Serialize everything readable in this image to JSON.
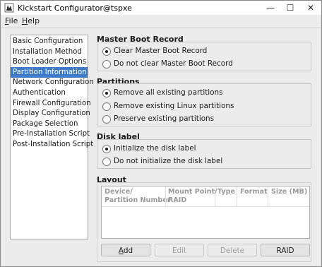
{
  "window": {
    "title": "Kickstart Configurator@tspxe",
    "minimize_glyph": "—",
    "maximize_glyph": "☐",
    "close_glyph": "✕"
  },
  "menu": {
    "file_ul": "F",
    "file_rest": "ile",
    "help_ul": "H",
    "help_rest": "elp"
  },
  "sidebar": {
    "items": [
      "Basic Configuration",
      "Installation Method",
      "Boot Loader Options",
      "Partition Information",
      "Network Configuration",
      "Authentication",
      "Firewall Configuration",
      "Display Configuration",
      "Package Selection",
      "Pre-Installation Script",
      "Post-Installation Script"
    ],
    "selected": "Partition Information"
  },
  "mbr": {
    "title": "Master Boot Record",
    "options": [
      "Clear Master Boot Record",
      "Do not clear Master Boot Record"
    ],
    "selected": "Clear Master Boot Record"
  },
  "partitions": {
    "title": "Partitions",
    "options": [
      "Remove all existing partitions",
      "Remove existing Linux partitions",
      "Preserve existing partitions"
    ],
    "selected": "Remove all existing partitions"
  },
  "disk_label": {
    "title": "Disk label",
    "options": [
      "Initialize the disk label",
      "Do not initialize the disk label"
    ],
    "selected": "Initialize the disk label"
  },
  "layout": {
    "title": "Layout",
    "columns": {
      "device_1": "Device/",
      "device_2": "Partition Number",
      "mount_1": "Mount Point/",
      "mount_2": "RAID",
      "type": "Type",
      "format": "Format",
      "size": "Size (MB)"
    },
    "rows": []
  },
  "buttons": {
    "add_ul": "A",
    "add_rest": "dd",
    "edit": "Edit",
    "delete": "Delete",
    "raid": "RAID"
  }
}
